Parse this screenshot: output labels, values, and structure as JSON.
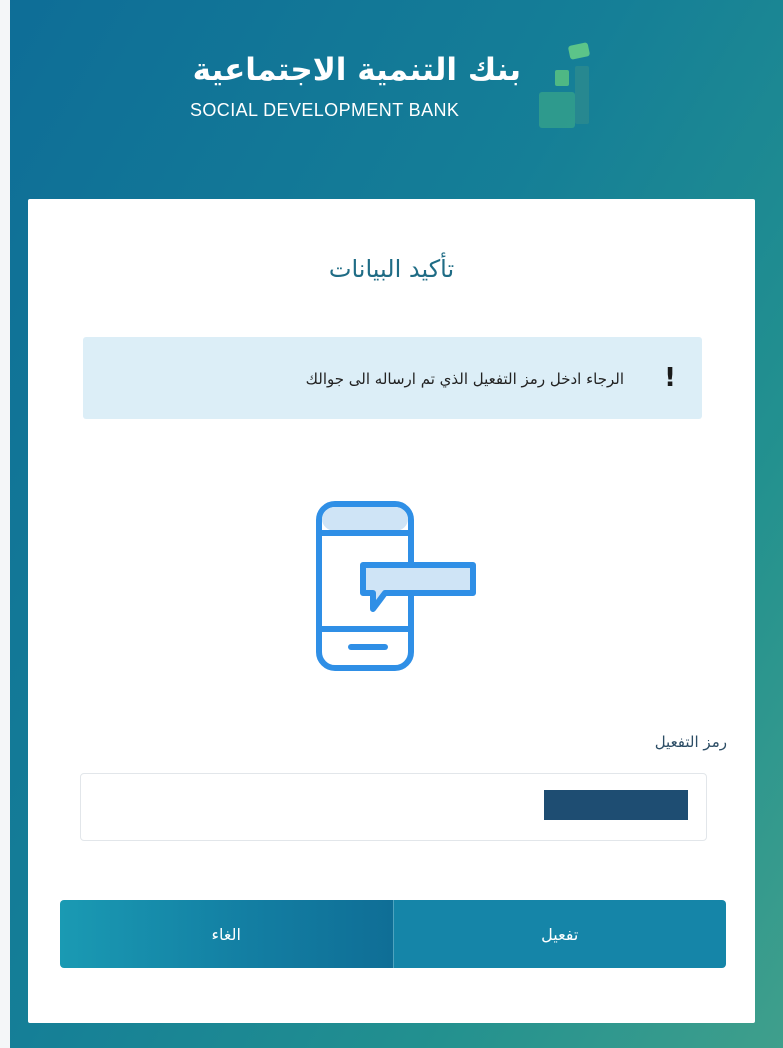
{
  "brand": {
    "name_ar": "بنك التنمية الاجتماعية",
    "name_en": "SOCIAL DEVELOPMENT BANK",
    "colors": {
      "primary": "#1585a8",
      "accent_green": "#5cc489",
      "dark_navy": "#1e4d72"
    }
  },
  "card": {
    "title": "تأكيد البيانات",
    "alert": {
      "icon": "exclamation-icon",
      "text": "الرجاء ادخل رمز التفعيل الذي تم ارساله الى جوالك"
    },
    "illustration": "phone-sms-icon",
    "code_field": {
      "label": "رمز التفعيل",
      "value": "",
      "placeholder": ""
    },
    "buttons": {
      "cancel_label": "الغاء",
      "activate_label": "تفعيل"
    }
  }
}
